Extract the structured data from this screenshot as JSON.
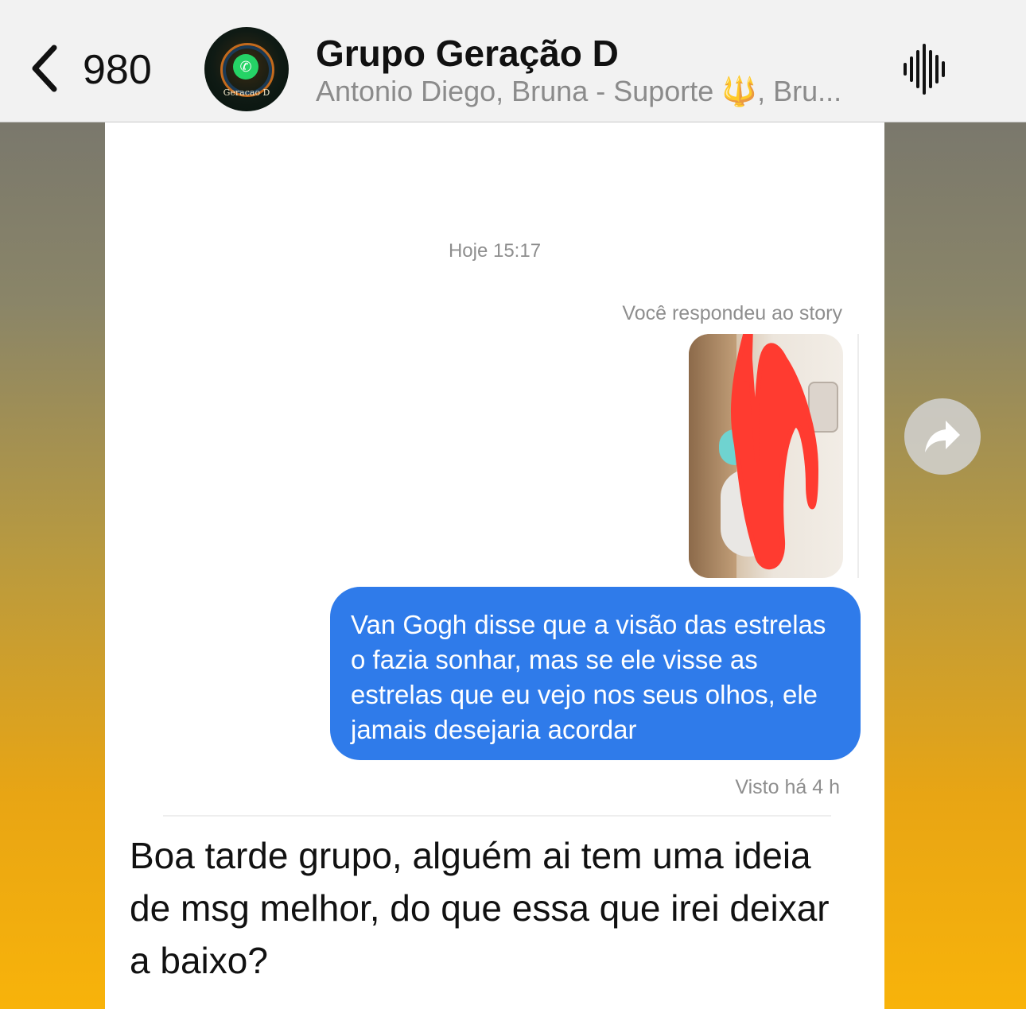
{
  "header": {
    "back_count": "980",
    "title": "Grupo Geração D",
    "members": "Antonio Diego, Bruna - Suporte 🔱, Bru...",
    "avatar_caption": "Geracao D"
  },
  "screenshot": {
    "timestamp": "Hoje 15:17",
    "reply_caption": "Você respondeu ao story",
    "message": "Van Gogh disse que a visão das estrelas o fazia sonhar, mas se ele visse as estrelas que eu vejo nos seus olhos, ele jamais desejaria acordar",
    "seen": "Visto há 4 h"
  },
  "caption": {
    "text": "Boa tarde grupo, alguém ai tem uma ideia de msg melhor, do que essa que irei deixar a baixo?"
  },
  "icons": {
    "back": "chevron-left-icon",
    "audio": "audio-waveform-icon",
    "forward": "forward-arrow-icon",
    "avatar_logo": "whatsapp-icon"
  },
  "colors": {
    "bubble_blue": "#2f7bea",
    "redaction_red": "#ff3b30",
    "header_bg": "#f2f2f2"
  }
}
